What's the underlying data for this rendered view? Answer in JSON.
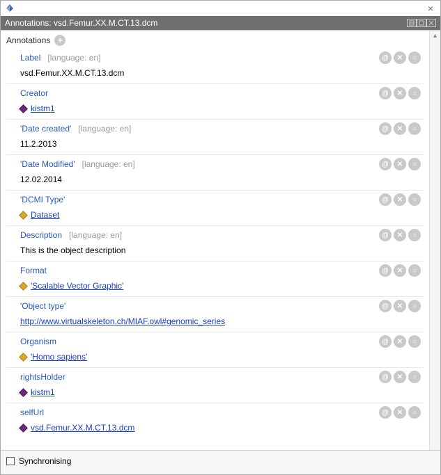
{
  "window_title": "Annotations: vsd.Femur.XX.M.CT.13.dcm",
  "section_head": "Annotations",
  "lang_en": "[language: en]",
  "rows": {
    "label": {
      "prop": "Label",
      "has_lang": true,
      "value": "vsd.Femur.XX.M.CT.13.dcm",
      "link": false
    },
    "creator": {
      "prop": "Creator",
      "has_lang": false,
      "value": "kistm1",
      "link": true,
      "icon": "purple"
    },
    "date_created": {
      "prop": "'Date created'",
      "has_lang": true,
      "value": "11.2.2013",
      "link": false
    },
    "date_modified": {
      "prop": "'Date Modified'",
      "has_lang": true,
      "value": "12.02.2014",
      "link": false
    },
    "dcmi_type": {
      "prop": "'DCMI Type'",
      "has_lang": false,
      "value": "Dataset",
      "link": true,
      "icon": "gold"
    },
    "description": {
      "prop": "Description",
      "has_lang": true,
      "value": "This is the object description",
      "link": false
    },
    "format": {
      "prop": "Format",
      "has_lang": false,
      "value": "'Scalable Vector Graphic'",
      "link": true,
      "icon": "gold"
    },
    "object_type": {
      "prop": "'Object type'",
      "has_lang": false,
      "value": "http://www.virtualskeleton.ch/MIAF.owl#genomic_series",
      "link": true
    },
    "organism": {
      "prop": "Organism",
      "has_lang": false,
      "value": "'Homo sapiens'",
      "link": true,
      "icon": "gold"
    },
    "rights": {
      "prop": "rightsHolder",
      "has_lang": false,
      "value": "kistm1",
      "link": true,
      "icon": "purple"
    },
    "selfurl": {
      "prop": "selfUrl",
      "has_lang": false,
      "value": "vsd.Femur.XX.M.CT.13.dcm",
      "link": true,
      "icon": "purple"
    }
  },
  "footer": {
    "sync_label": "Synchronising"
  }
}
